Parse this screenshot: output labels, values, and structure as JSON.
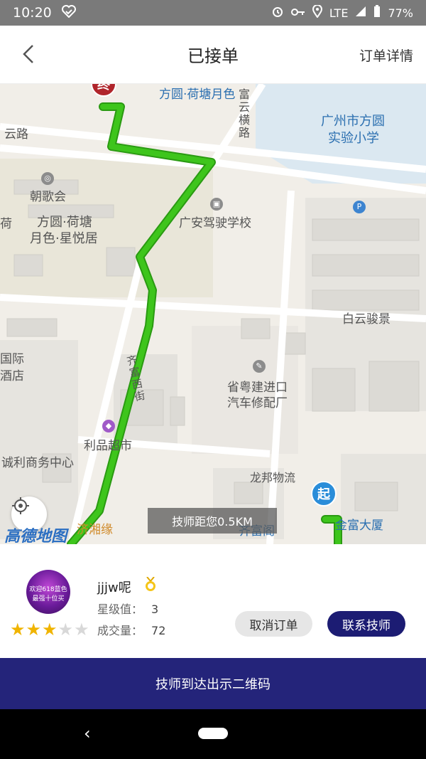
{
  "status_bar": {
    "time": "10:20",
    "network": "LTE",
    "battery": "77%"
  },
  "header": {
    "title": "已接单",
    "detail_link": "订单详情"
  },
  "map": {
    "labels": {
      "fangyuan_top": "方圆·荷塘月色",
      "road_fuyun": "富云横路",
      "yunlu": "云路",
      "school_line1": "广州市方圆",
      "school_line2": "实验小学",
      "chaoge": "朝歌会",
      "he": "荷",
      "fangyuan_mid_line1": "方圆·荷塘",
      "fangyuan_mid_line2": "月色·星悦居",
      "driving_school": "广安驾驶学校",
      "baiyun": "白云骏景",
      "guoji": "国际",
      "jiudian": "酒店",
      "repair_line1": "省粤建进口",
      "repair_line2": "汽车修配厂",
      "road_qifu": "齐富西街",
      "supermarket": "利品超市",
      "business_center": "诚利商务中心",
      "longbang": "龙邦物流",
      "xiangyuan": "济湘缘",
      "jinfu": "金富大厦",
      "qifuge": "齐富阁"
    },
    "brand": "高德地图",
    "start_marker": "起",
    "end_marker": "终",
    "distance_tip": "技师距您0.5KM",
    "route_color": "#3ec51c"
  },
  "technician": {
    "avatar_text": "欢迎618蓝色 最强十位买",
    "name": "jjjw呢",
    "rating_label": "星级值：",
    "rating_value": "3",
    "orders_label": "成交量：",
    "orders_value": "72",
    "stars_filled": 3,
    "stars_total": 5
  },
  "actions": {
    "cancel": "取消订单",
    "contact": "联系技师",
    "show_qr": "技师到达出示二维码"
  },
  "colors": {
    "primary": "#24247a",
    "star": "#f0b400"
  }
}
